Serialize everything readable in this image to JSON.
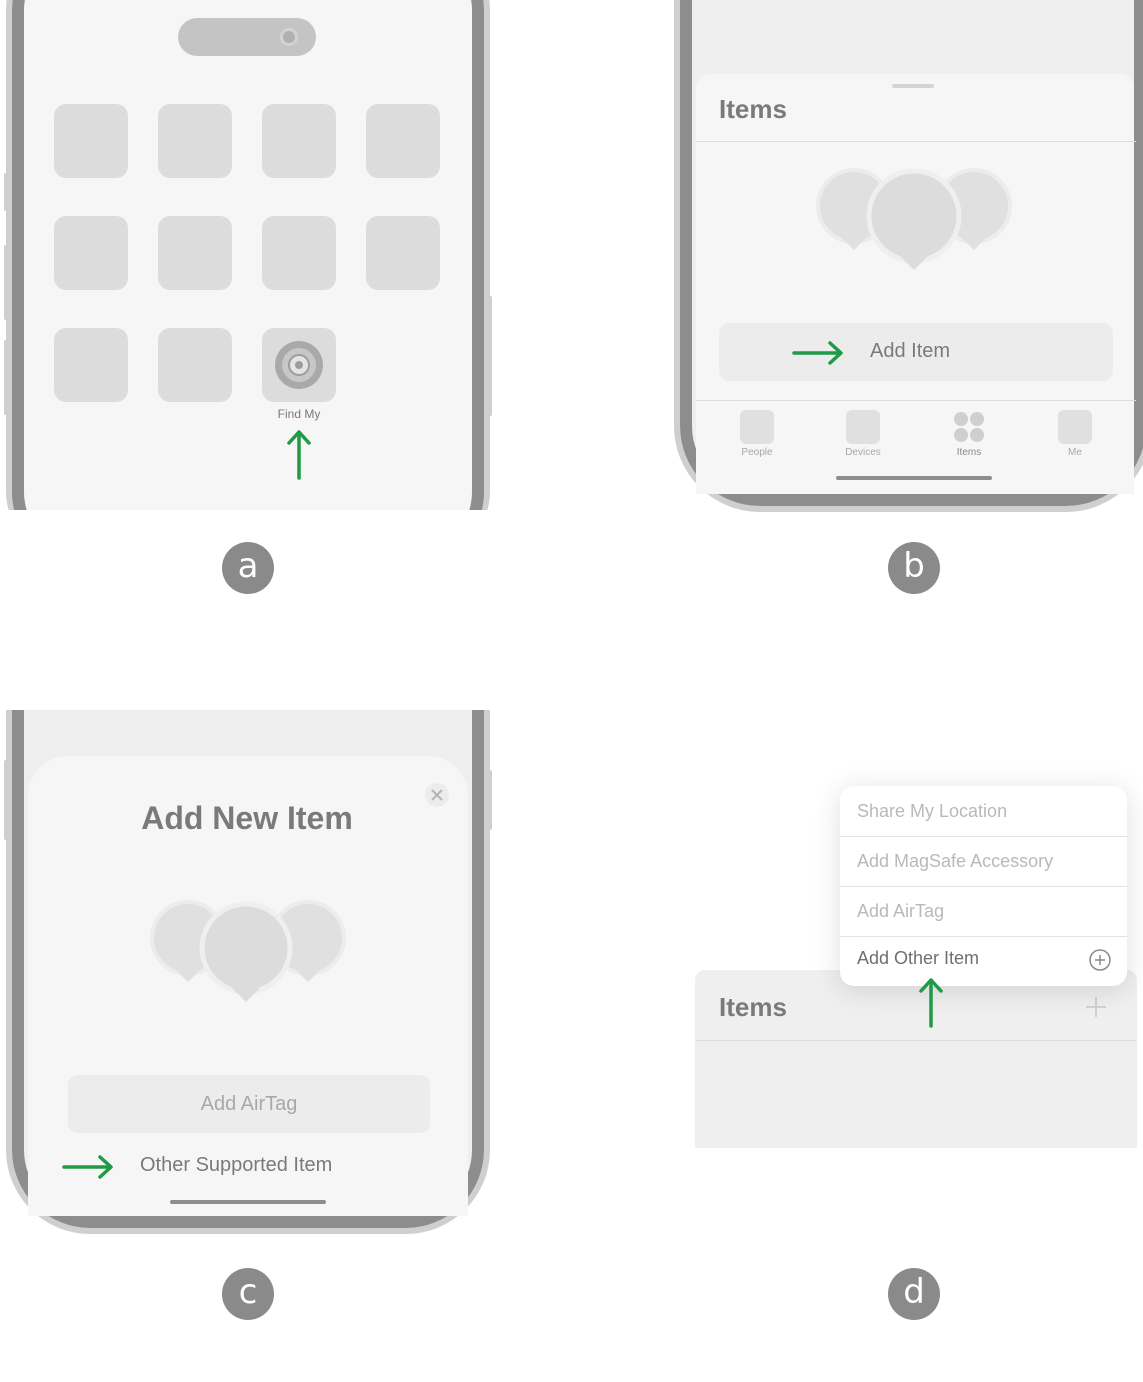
{
  "colors": {
    "arrow_green": "#1f9a47",
    "frame_gray": "#8d8d8d",
    "placeholder_gray": "#dcdcdc"
  },
  "panel_a": {
    "badge": "a",
    "app_label": "Find My",
    "icon": "find-my-icon"
  },
  "panel_b": {
    "badge": "b",
    "title": "Items",
    "add_button": "Add Item",
    "tabs": [
      "People",
      "Devices",
      "Items",
      "Me"
    ]
  },
  "panel_c": {
    "badge": "c",
    "title": "Add New Item",
    "add_airtag": "Add AirTag",
    "other_item": "Other Supported Item",
    "close_icon": "close-icon"
  },
  "panel_d": {
    "badge": "d",
    "menu_items": [
      "Share My Location",
      "Add MagSafe Accessory",
      "Add AirTag",
      "Add Other Item"
    ],
    "title": "Items",
    "plus_icon": "plus-icon"
  }
}
